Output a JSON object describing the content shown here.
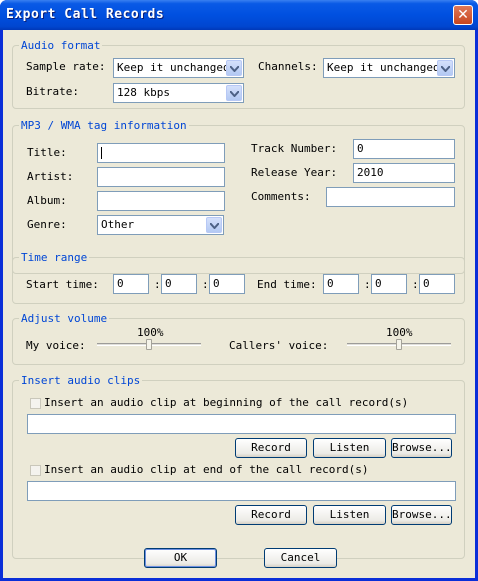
{
  "window": {
    "title": "Export Call Records",
    "close_glyph": "✕"
  },
  "audio_format": {
    "legend": "Audio format",
    "sample_rate_label": "Sample rate:",
    "sample_rate_value": "Keep it unchanged",
    "channels_label": "Channels:",
    "channels_value": "Keep it unchanged",
    "bitrate_label": "Bitrate:",
    "bitrate_value": "128 kbps"
  },
  "tags": {
    "legend": "MP3 / WMA tag information",
    "title_label": "Title:",
    "title_value": "",
    "artist_label": "Artist:",
    "artist_value": "",
    "album_label": "Album:",
    "album_value": "",
    "genre_label": "Genre:",
    "genre_value": "Other",
    "track_label": "Track Number:",
    "track_value": "0",
    "year_label": "Release Year:",
    "year_value": "2010",
    "comments_label": "Comments:",
    "comments_value": ""
  },
  "time_range": {
    "legend": "Time range",
    "start_label": "Start time:",
    "start": [
      "0",
      "0",
      "0"
    ],
    "end_label": "End time:",
    "end": [
      "0",
      "0",
      "0"
    ],
    "separator": ":"
  },
  "volume": {
    "legend": "Adjust volume",
    "my_voice_label": "My voice:",
    "my_voice_percent": "100%",
    "my_voice_level": 0.5,
    "callers_label": "Callers' voice:",
    "callers_percent": "100%",
    "callers_level": 0.5
  },
  "clips": {
    "legend": "Insert audio clips",
    "begin_label": "Insert an audio clip at beginning of the call record(s)",
    "begin_checked": false,
    "begin_path": "",
    "end_label": "Insert an audio clip at end of the call record(s)",
    "end_checked": false,
    "end_path": "",
    "record": "Record",
    "listen": "Listen",
    "browse": "Browse..."
  },
  "footer": {
    "ok": "OK",
    "cancel": "Cancel"
  }
}
